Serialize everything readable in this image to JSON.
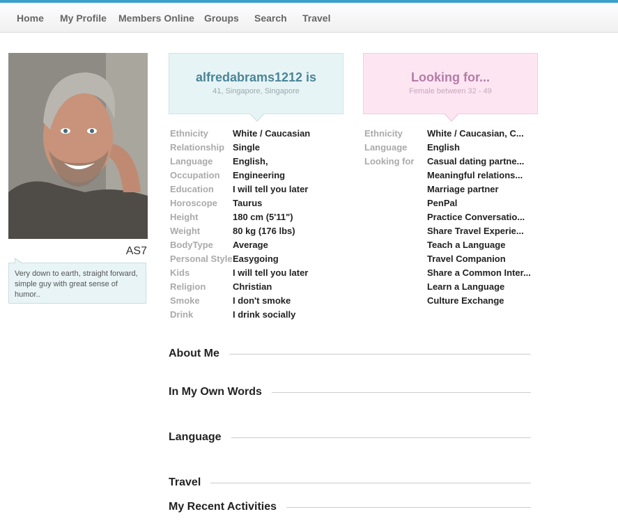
{
  "nav": [
    "Home",
    "My Profile",
    "Members Online",
    "Groups",
    "Search",
    "Travel"
  ],
  "profile": {
    "short_name": "AS7",
    "bio": "Very down to earth, straight forward, simple guy with great sense of humor..",
    "username_line": "alfredabrams1212 is",
    "location_line": "41, Singapore, Singapore"
  },
  "seeking": {
    "title": "Looking for...",
    "subtitle": "Female between 32 - 49"
  },
  "me_attributes": [
    {
      "label": "Ethnicity",
      "value": "White / Caucasian"
    },
    {
      "label": "Relationship",
      "value": "Single"
    },
    {
      "label": "Language",
      "value": "English,"
    },
    {
      "label": "Occupation",
      "value": "Engineering"
    },
    {
      "label": "Education",
      "value": "I will tell you later"
    },
    {
      "label": "Horoscope",
      "value": "Taurus"
    },
    {
      "label": "Height",
      "value": "180 cm (5'11\")"
    },
    {
      "label": "Weight",
      "value": "80 kg (176 lbs)"
    },
    {
      "label": "BodyType",
      "value": "Average"
    },
    {
      "label": "Personal Style",
      "value": "Easygoing"
    },
    {
      "label": "Kids",
      "value": "I will tell you later"
    },
    {
      "label": "Religion",
      "value": "Christian"
    },
    {
      "label": "Smoke",
      "value": "I don't smoke"
    },
    {
      "label": "Drink",
      "value": "I drink socially"
    }
  ],
  "seek_attributes": [
    {
      "label": "Ethnicity",
      "value": "White / Caucasian, C..."
    },
    {
      "label": "Language",
      "value": "English"
    },
    {
      "label": "Looking for",
      "value": "Casual dating partne..."
    },
    {
      "label": "",
      "value": "Meaningful relations..."
    },
    {
      "label": "",
      "value": "Marriage partner"
    },
    {
      "label": "",
      "value": "PenPal"
    },
    {
      "label": "",
      "value": "Practice Conversatio..."
    },
    {
      "label": "",
      "value": "Share Travel Experie..."
    },
    {
      "label": "",
      "value": "Teach a Language"
    },
    {
      "label": "",
      "value": "Travel Companion"
    },
    {
      "label": "",
      "value": ""
    },
    {
      "label": "",
      "value": "Share a Common Inter..."
    },
    {
      "label": "",
      "value": "Learn a Language"
    },
    {
      "label": "",
      "value": "Culture Exchange"
    }
  ],
  "sections": [
    "About Me",
    "In My Own Words",
    "Language",
    "Travel",
    "My Recent Activities"
  ],
  "colors": {
    "accent_top": "#3aa0c8",
    "me_card": "#e7f4f6",
    "seek_card": "#fde6f2",
    "me_title": "#4a8598",
    "seek_title": "#b57ca8"
  }
}
